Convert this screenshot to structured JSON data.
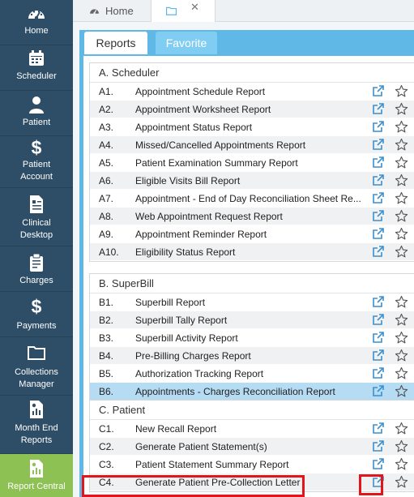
{
  "sidebar": {
    "items": [
      {
        "label": "Home",
        "icon": "dashboard-icon"
      },
      {
        "label": "Scheduler",
        "icon": "calendar-icon"
      },
      {
        "label": "Patient",
        "icon": "user-icon"
      },
      {
        "label": "Patient Account",
        "icon": "dollar-icon"
      },
      {
        "label": "Clinical Desktop",
        "icon": "document-icon"
      },
      {
        "label": "Charges",
        "icon": "clipboard-icon"
      },
      {
        "label": "Payments",
        "icon": "dollar-icon"
      },
      {
        "label": "Collections Manager",
        "icon": "folder-icon"
      },
      {
        "label": "Month End Reports",
        "icon": "report-icon"
      },
      {
        "label": "Report Central",
        "icon": "report-icon",
        "active": true
      }
    ]
  },
  "topbar": {
    "home_label": "Home"
  },
  "tabs": {
    "reports": "Reports",
    "favorite": "Favorite"
  },
  "sections": [
    {
      "title": "A. Scheduler",
      "rows": [
        {
          "code": "A1.",
          "title": "Appointment Schedule Report"
        },
        {
          "code": "A2.",
          "title": "Appointment Worksheet Report"
        },
        {
          "code": "A3.",
          "title": "Appointment Status Report"
        },
        {
          "code": "A4.",
          "title": "Missed/Cancelled Appointments Report"
        },
        {
          "code": "A5.",
          "title": "Patient Examination Summary Report"
        },
        {
          "code": "A6.",
          "title": "Eligible Visits Bill Report"
        },
        {
          "code": "A7.",
          "title": "Appointment - End of Day Reconciliation Sheet Re..."
        },
        {
          "code": "A8.",
          "title": "Web Appointment Request Report"
        },
        {
          "code": "A9.",
          "title": "Appointment Reminder Report"
        },
        {
          "code": "A10.",
          "title": "Eligibility Status Report"
        }
      ]
    },
    {
      "title": "B. SuperBill",
      "rows": [
        {
          "code": "B1.",
          "title": "Superbill Report"
        },
        {
          "code": "B2.",
          "title": "Superbill Tally Report"
        },
        {
          "code": "B3.",
          "title": "Superbill Activity Report"
        },
        {
          "code": "B4.",
          "title": "Pre-Billing Charges Report"
        },
        {
          "code": "B5.",
          "title": "Authorization Tracking Report"
        },
        {
          "code": "B6.",
          "title": "Appointments - Charges Reconciliation Report",
          "selected": true
        }
      ]
    },
    {
      "title": "C. Patient",
      "rows": [
        {
          "code": "C1.",
          "title": "New Recall Report"
        },
        {
          "code": "C2.",
          "title": "Generate Patient Statement(s)"
        },
        {
          "code": "C3.",
          "title": "Patient Statement Summary Report"
        },
        {
          "code": "C4.",
          "title": "Generate Patient Pre-Collection Letter",
          "highlighted": true
        }
      ]
    }
  ],
  "colors": {
    "sidebar": "#2e4d66",
    "active_nav": "#8dc154",
    "tab_bar": "#5fb8e6",
    "selected_row": "#b6dcf4",
    "highlight": "#e3151a",
    "open_icon": "#3a8fcf"
  }
}
